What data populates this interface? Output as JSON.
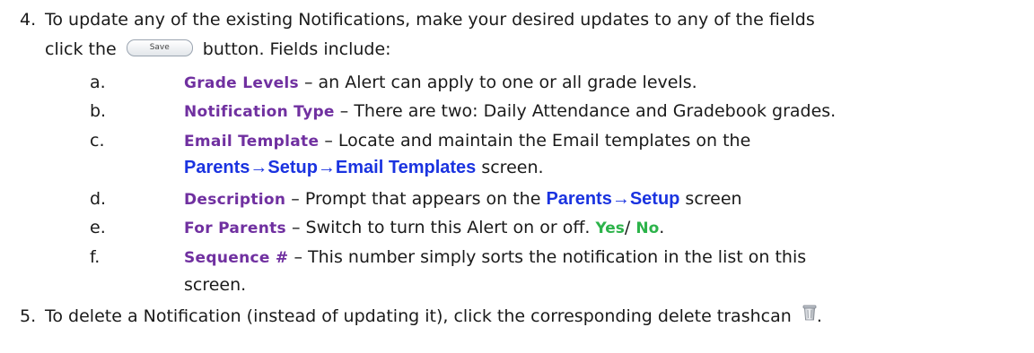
{
  "step4": {
    "number": "4.",
    "text_before_button": "To update any of the existing Notifications, make your desired updates to any of the fields",
    "text_click": "click the",
    "save_button_label": "Save",
    "text_after_button": "button.  Fields include:"
  },
  "fields": [
    {
      "letter": "a.",
      "term": "Grade Levels",
      "desc": " – an Alert can apply to one or all grade levels."
    },
    {
      "letter": "b.",
      "term": "Notification Type",
      "desc": " – There are two:  Daily Attendance and Gradebook grades."
    },
    {
      "letter": "c.",
      "term": "Email Template",
      "desc": " – Locate and maintain the Email templates on the",
      "desc_line2_link": "Parents→Setup→Email Templates",
      "desc_line2_rest": " screen."
    },
    {
      "letter": "d.",
      "term": "Description",
      "desc": " – Prompt that appears on the ",
      "desc_link": "Parents→Setup",
      "desc_rest": " screen"
    },
    {
      "letter": "e.",
      "term": "For Parents",
      "desc": " – Switch to turn this Alert on or off.  ",
      "yes": "Yes",
      "slash": "/ ",
      "no": "No",
      "end": "."
    },
    {
      "letter": "f.",
      "term": "Sequence #",
      "desc": " – This number simply sorts the notification in the list on this",
      "desc_line2": "screen."
    }
  ],
  "step5": {
    "number": "5.",
    "text": "To delete a Notification (instead of updating it), click the corresponding delete trashcan",
    "end": "."
  },
  "colors": {
    "term": "#7030a0",
    "link": "#1a33e0",
    "yes_no": "#2cb34a"
  },
  "icons": {
    "trash": "trashcan-icon"
  }
}
